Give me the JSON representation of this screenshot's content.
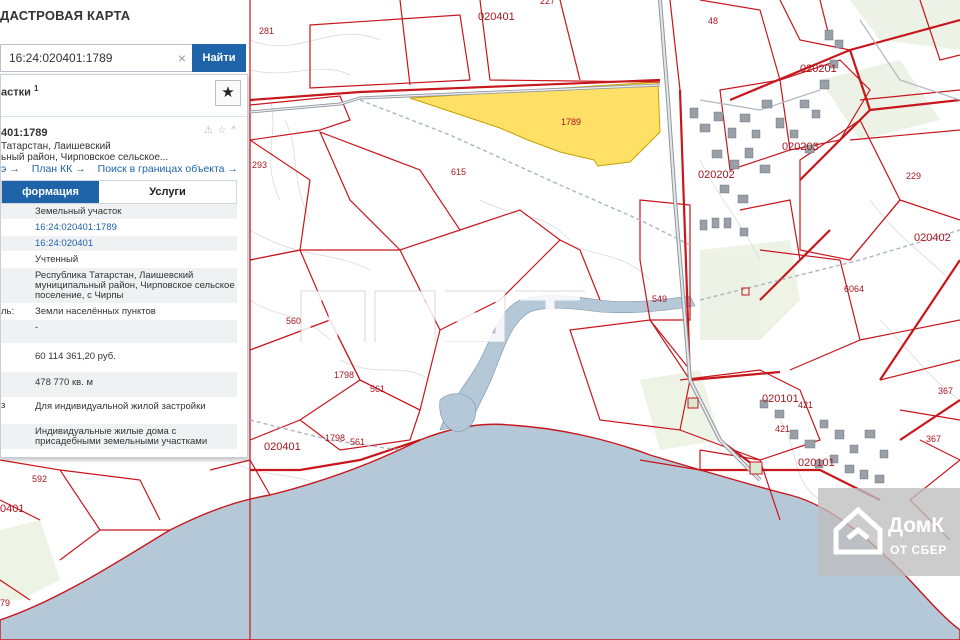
{
  "app": {
    "title": "ДАСТРОВАЯ КАРТА"
  },
  "search": {
    "value": "16:24:020401:1789",
    "clear_glyph": "×",
    "button_label": "Найти"
  },
  "panel": {
    "header_title": "астки",
    "header_count": "1",
    "star_icon": "star-icon",
    "object_number": "401:1789",
    "object_icons": "⚠ ☆ ^",
    "address_line1": "Татарстан, Лаишевский",
    "address_line2": "ьный район, Чирповское сельское...",
    "links": [
      "э →",
      "План КК →",
      "Поиск в границах объекта →"
    ],
    "tabs": {
      "info": "формация",
      "services": "Услуги"
    },
    "rows": [
      {
        "key": "",
        "value": "Земельный участок",
        "link": false
      },
      {
        "key": "",
        "value": "16:24:020401:1789",
        "link": true
      },
      {
        "key": "",
        "value": "16:24:020401",
        "link": true
      },
      {
        "key": "",
        "value": "Учтенный",
        "link": false
      },
      {
        "key": "",
        "value": "Республика Татарстан, Лаишевский муниципальный район, Чирповское сельское поселение, с Чирпы",
        "link": false
      },
      {
        "key": "ль:",
        "value": "Земли населённых пунктов",
        "link": false
      },
      {
        "key": "",
        "value": "-",
        "link": false
      },
      {
        "key": "",
        "value": "60 114 361,20 руб.",
        "link": false
      },
      {
        "key": "",
        "value": "478 770 кв. м",
        "link": false
      },
      {
        "key": "з",
        "value": "Для индивидуальной жилой застройки",
        "link": false
      },
      {
        "key": "",
        "value": "Индивидуальные жилые дома с присадебными земельными участками",
        "link": false
      }
    ]
  },
  "map": {
    "quarters": [
      "020401",
      "020401",
      "020201",
      "020203",
      "020202",
      "020402",
      "020101",
      "020101",
      "020401",
      "0401"
    ],
    "parcels": [
      "1789",
      "615",
      "281",
      "293",
      "227",
      "48",
      "229",
      "6064",
      "549",
      "560",
      "1798",
      "561",
      "1798",
      "561",
      "421",
      "421",
      "367",
      "367",
      "592",
      "79"
    ],
    "colors": {
      "parcel_border": "#c8161d",
      "highlight": "#ffe066",
      "water": "#b5c8d8",
      "road": "#8c96a0"
    }
  },
  "watermark": {
    "icon": "fpzt-watermark-logo"
  },
  "branding": {
    "name": "ДомК",
    "sub": "ОТ СБЕР",
    "icon": "house-icon"
  }
}
